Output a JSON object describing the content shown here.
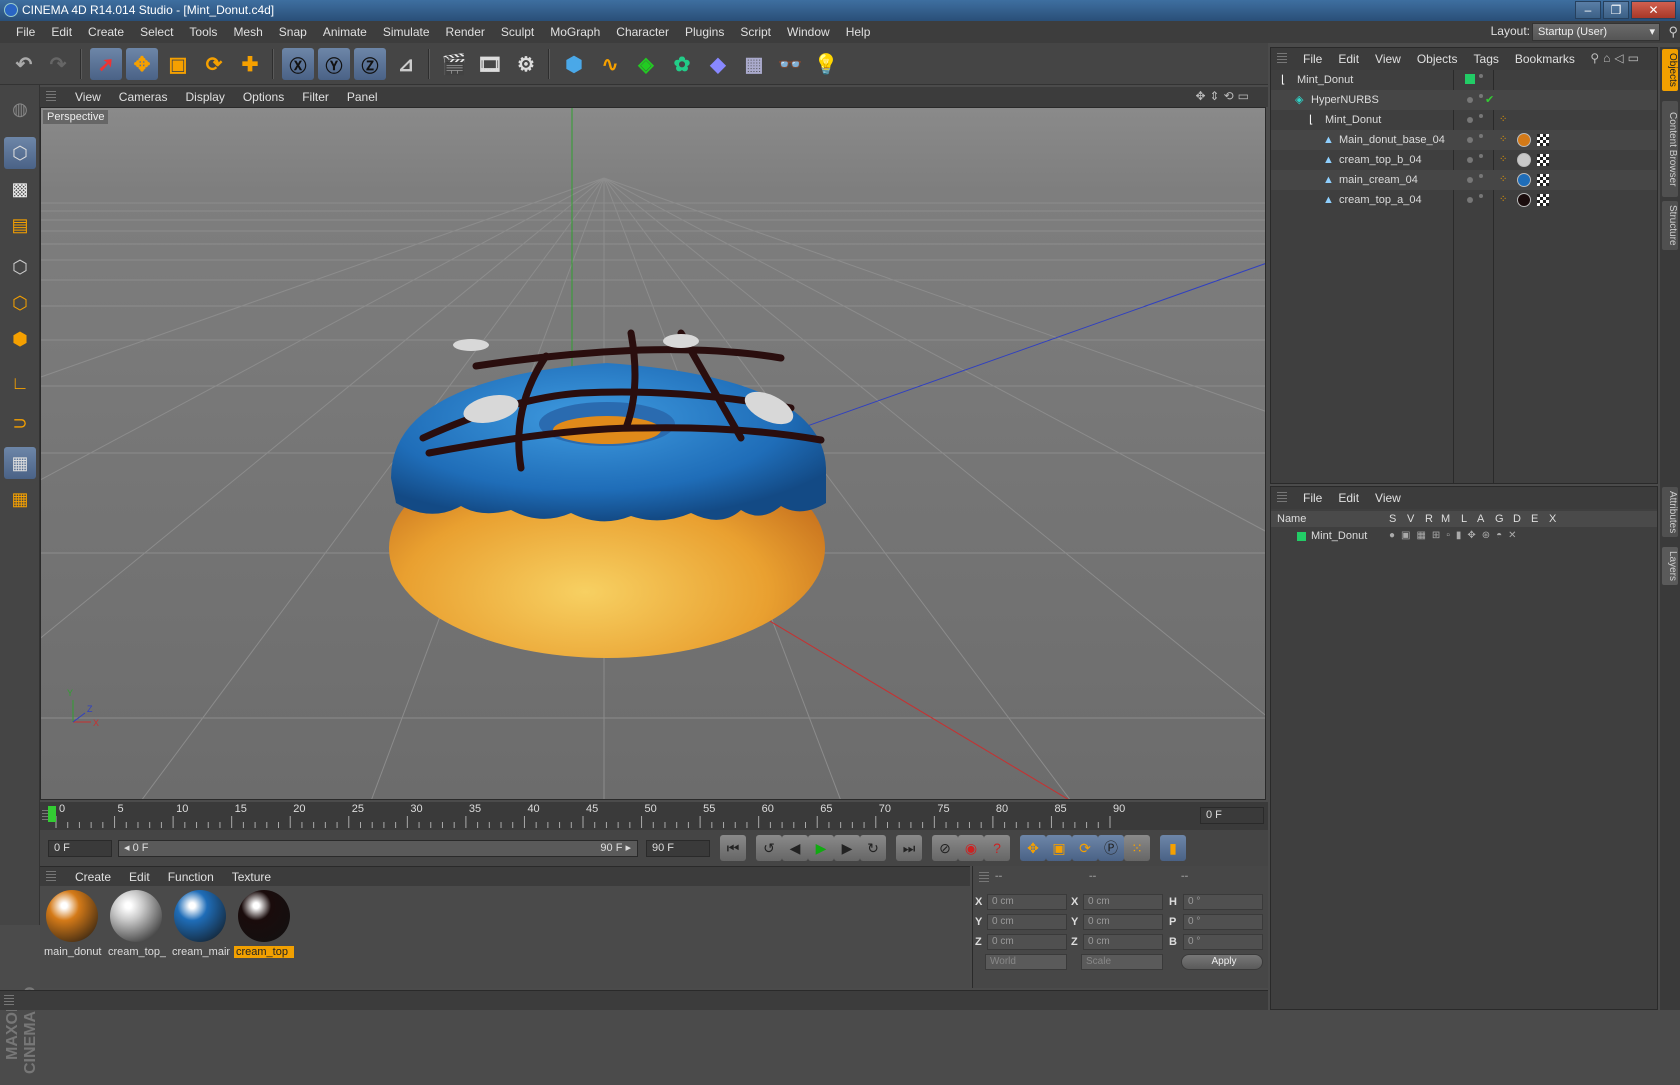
{
  "window": {
    "title": "CINEMA 4D R14.014 Studio - [Mint_Donut.c4d]",
    "min": "–",
    "max": "❐",
    "close": "✕"
  },
  "menu": [
    "File",
    "Edit",
    "Create",
    "Select",
    "Tools",
    "Mesh",
    "Snap",
    "Animate",
    "Simulate",
    "Render",
    "Sculpt",
    "MoGraph",
    "Character",
    "Plugins",
    "Script",
    "Window",
    "Help"
  ],
  "layout": {
    "label": "Layout:",
    "value": "Startup (User)"
  },
  "viewport": {
    "menu": [
      "View",
      "Cameras",
      "Display",
      "Options",
      "Filter",
      "Panel"
    ],
    "label": "Perspective",
    "axis": {
      "y": "Y",
      "z": "Z",
      "x": "X"
    }
  },
  "timeline": {
    "ticks": [
      "0",
      "5",
      "10",
      "15",
      "20",
      "25",
      "30",
      "35",
      "40",
      "45",
      "50",
      "55",
      "60",
      "65",
      "70",
      "75",
      "80",
      "85",
      "90"
    ],
    "frame_field": "0 F"
  },
  "transport": {
    "start": "0 F",
    "range_start": "◂ 0 F",
    "range_end": "90 F ▸",
    "end": "90 F"
  },
  "materials": {
    "menu": [
      "Create",
      "Edit",
      "Function",
      "Texture"
    ],
    "items": [
      {
        "label": "main_donut",
        "color": "#d47a18"
      },
      {
        "label": "cream_top_",
        "color": "#c8c8c8"
      },
      {
        "label": "cream_main",
        "color": "#1f6db8"
      },
      {
        "label": "cream_top",
        "color": "#1a0c0c"
      }
    ]
  },
  "coords": {
    "header": [
      "--",
      "--",
      "--"
    ],
    "rows": [
      {
        "l1": "X",
        "v1": "0 cm",
        "l2": "X",
        "v2": "0 cm",
        "l3": "H",
        "v3": "0 °"
      },
      {
        "l1": "Y",
        "v1": "0 cm",
        "l2": "Y",
        "v2": "0 cm",
        "l3": "P",
        "v3": "0 °"
      },
      {
        "l1": "Z",
        "v1": "0 cm",
        "l2": "Z",
        "v2": "0 cm",
        "l3": "B",
        "v3": "0 °"
      }
    ],
    "world": "World",
    "scale": "Scale",
    "apply": "Apply"
  },
  "objects": {
    "menu": [
      "File",
      "Edit",
      "View",
      "Objects",
      "Tags",
      "Bookmarks"
    ],
    "rows": [
      {
        "name": "Mint_Donut",
        "indent": 0
      },
      {
        "name": "HyperNURBS",
        "indent": 1
      },
      {
        "name": "Mint_Donut",
        "indent": 2
      },
      {
        "name": "Main_donut_base_04",
        "indent": 3
      },
      {
        "name": "cream_top_b_04",
        "indent": 3
      },
      {
        "name": "main_cream_04",
        "indent": 3
      },
      {
        "name": "cream_top_a_04",
        "indent": 3
      }
    ]
  },
  "layers": {
    "menu": [
      "File",
      "Edit",
      "View"
    ],
    "header": {
      "name": "Name",
      "cols": [
        "S",
        "V",
        "R",
        "M",
        "L",
        "A",
        "G",
        "D",
        "E",
        "X"
      ]
    },
    "rows": [
      {
        "name": "Mint_Donut"
      }
    ]
  },
  "sidebar_tabs": [
    "Objects",
    "Content Browser",
    "Structure",
    "Attributes",
    "Layers"
  ],
  "branding": "MAXON CINEMA 4D",
  "colors": {
    "accent": "#f2a000",
    "layer": "#22cc66",
    "axis_x": "#c83030",
    "axis_y": "#30a030",
    "axis_z": "#3040c0"
  }
}
